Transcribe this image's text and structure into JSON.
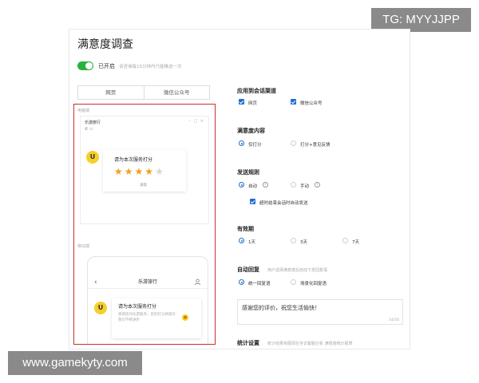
{
  "watermarks": {
    "top": "TG: MYYJJPP",
    "bottom": "www.gamekyty.com"
  },
  "page": {
    "title": "满意度调查",
    "toggle_label": "已开启",
    "toggle_hint": "该咨询每15分钟内只能推送一次",
    "tabs": [
      "网页",
      "微信公众号"
    ]
  },
  "preview": {
    "desktop_label": "电脑端",
    "mobile_label": "移动端",
    "desktop": {
      "brand": "乐游旅行",
      "window_controls": "– □ ×",
      "call_icons": "✆ ▭",
      "prompt": "请为本次服务打分",
      "rating_stars": 4,
      "rating_max": 5,
      "result_text": "满意"
    },
    "mobile": {
      "brand": "乐游旅行",
      "prompt": "请为本次服务打分",
      "desc": "感谢您对乐游服务，您的打分将提升",
      "desc2": "我们不断进步"
    }
  },
  "settings": {
    "channel": {
      "title": "应用到会话渠道",
      "options": [
        "网页",
        "微信公众号"
      ]
    },
    "content": {
      "title": "满意度内容",
      "options": [
        "仅打分",
        "打分+意见反馈"
      ],
      "selected": 0
    },
    "send_rule": {
      "title": "发送规则",
      "options": [
        "自动",
        "手动"
      ],
      "selected": 0,
      "extra_option": "超时结束会话时自动发送"
    },
    "validity": {
      "title": "有效期",
      "options": [
        "1天",
        "3天",
        "7天"
      ],
      "selected": 0
    },
    "auto_reply": {
      "title": "自动回复",
      "hint": "用户选择满意度后自动下发回复语",
      "options": [
        "统一回复语",
        "场景化回复语"
      ],
      "selected": 0
    },
    "reply_text": {
      "value": "感谢您的评价，祝您生活愉快！",
      "counter": "14/50"
    },
    "stats": {
      "title": "统计设置",
      "hint": "统计结果将展现在专访客服分析 满意度统计报表"
    }
  },
  "colors": {
    "accent": "#1f6fd0",
    "toggle_on": "#27b340",
    "frame_red": "#c9302c",
    "star": "#f0a020"
  }
}
